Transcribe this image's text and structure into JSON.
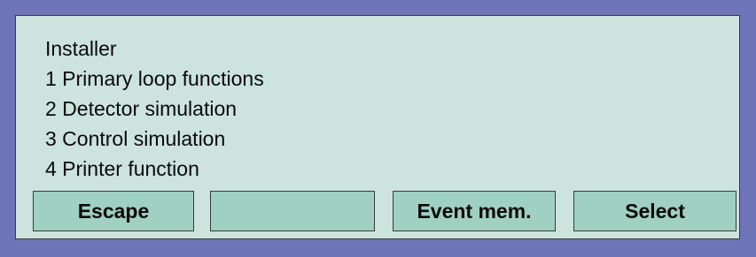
{
  "menu": {
    "title": "Installer",
    "items": [
      "1 Primary loop functions",
      "2 Detector simulation",
      "3 Control simulation",
      "4 Printer function"
    ]
  },
  "softkeys": {
    "key1": "Escape",
    "key2": "",
    "key3": "Event mem.",
    "key4": "Select"
  },
  "colors": {
    "frame": "#6f73b8",
    "screen": "#cde3de",
    "softkey": "#9fd0c2"
  }
}
